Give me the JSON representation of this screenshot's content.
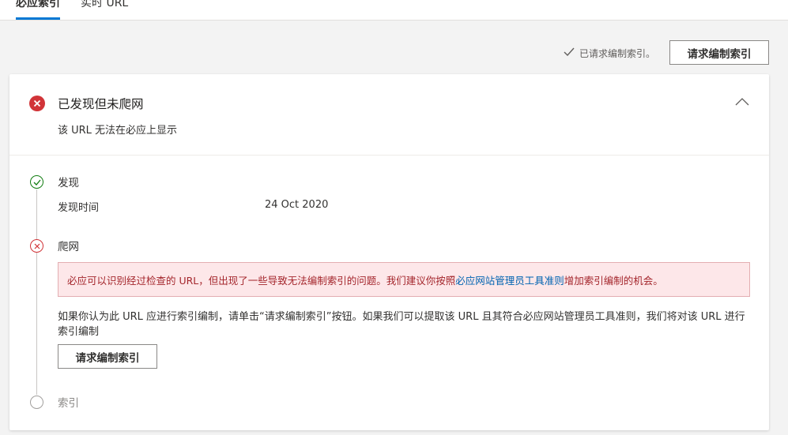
{
  "tabs": [
    {
      "label": "必应索引",
      "active": true
    },
    {
      "label": "实时 URL",
      "active": false
    }
  ],
  "top_status": {
    "check_icon": "check-icon",
    "text": "已请求编制索引。",
    "button_label": "请求编制索引"
  },
  "card": {
    "status_icon": "error-circle-icon",
    "title": "已发现但未爬网",
    "subtitle": "该 URL 无法在必应上显示",
    "collapse_icon": "chevron-up-icon"
  },
  "steps": [
    {
      "label": "发现",
      "state": "success",
      "icon": "check-circle-icon"
    },
    {
      "label": "爬网",
      "state": "error",
      "icon": "x-circle-icon"
    },
    {
      "label": "索引",
      "state": "pending",
      "icon": "empty-circle-icon"
    }
  ],
  "discovery": {
    "key": "发现时间",
    "value": "24 Oct 2020"
  },
  "crawl": {
    "error_before_link": "必应可以识别经过检查的 URL，但出现了一些导致无法编制索引的问题。我们建议你按照",
    "error_link": "必应网站管理员工具准则",
    "error_after_link": "增加索引编制的机会。",
    "hint": "如果你认为此 URL 应进行索引编制，请单击“请求编制索引”按钮。如果我们可以提取该 URL 且其符合必应网站管理员工具准则，我们将对该 URL 进行索引编制",
    "button_label": "请求编制索引"
  },
  "colors": {
    "accent": "#0078d4",
    "error": "#d13438",
    "success": "#107c10",
    "error_bg": "#fde7e9"
  }
}
